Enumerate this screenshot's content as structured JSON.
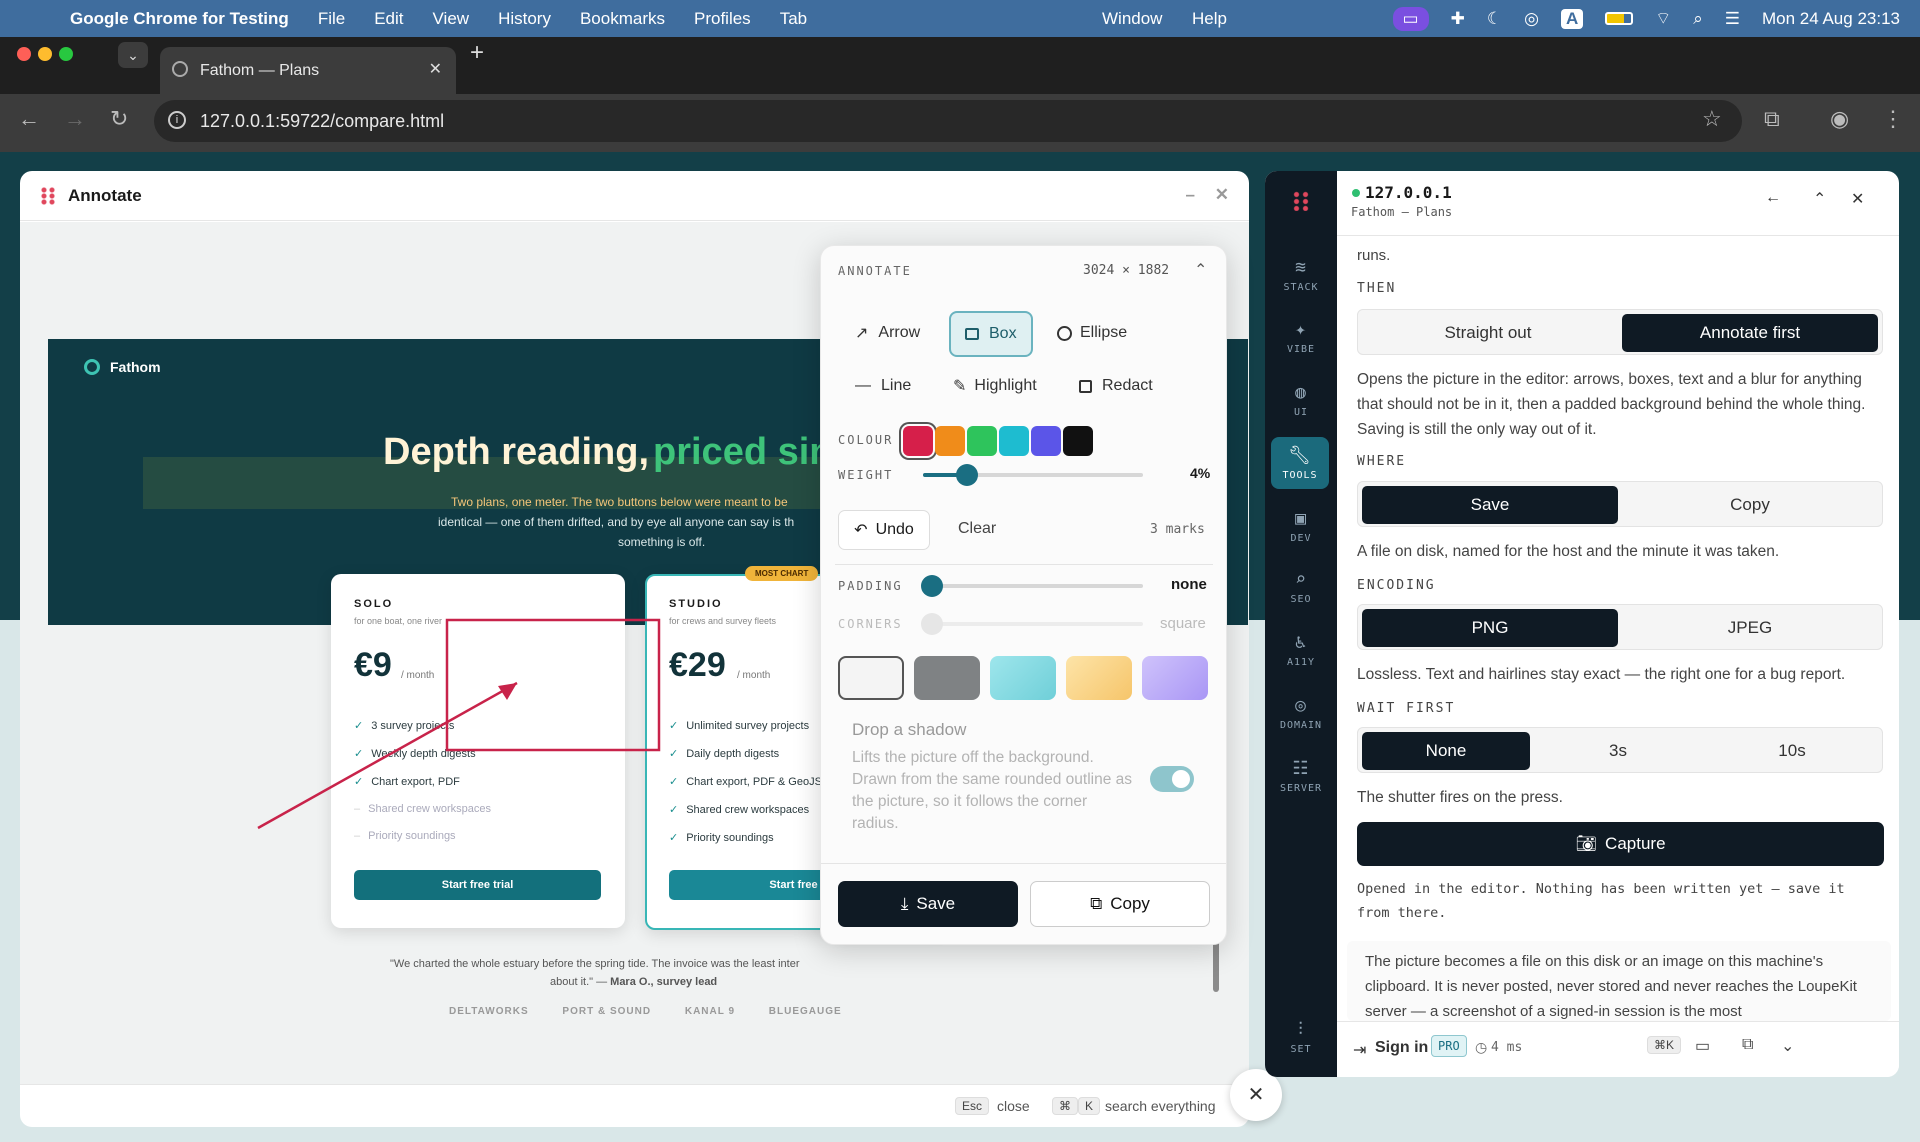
{
  "menubar": {
    "app": "Google Chrome for Testing",
    "items": [
      "File",
      "Edit",
      "View",
      "History",
      "Bookmarks",
      "Profiles",
      "Tab",
      "Window",
      "Help"
    ],
    "clock": "Mon 24 Aug  23:13"
  },
  "browser": {
    "tab_title": "Fathom — Plans",
    "url": "127.0.0.1:59722/compare.html"
  },
  "annotate": {
    "title": "Annotate",
    "footer": {
      "esc_key": "Esc",
      "esc_label": "close",
      "cmd_key": "⌘",
      "k_key": "K",
      "search_label": "search everything"
    },
    "preview": {
      "brand": "Fathom",
      "headline_a": "Depth reading,",
      "headline_b": "priced sin",
      "sub1": "Two plans, one meter. The two buttons below were meant to be",
      "sub2": "identical — one of them drifted, and by eye all anyone can say is th",
      "sub3": "something is off.",
      "solo": {
        "name": "SOLO",
        "tag": "for one boat, one river",
        "price": "€9",
        "per": "/ month",
        "features": [
          "3 survey projects",
          "Weekly depth digests",
          "Chart export, PDF",
          "Shared crew workspaces",
          "Priority soundings"
        ],
        "cta": "Start free trial"
      },
      "studio": {
        "badge": "MOST CHART",
        "name": "STUDIO",
        "tag": "for crews and survey fleets",
        "price": "€29",
        "per": "/ month",
        "features": [
          "Unlimited survey projects",
          "Daily depth digests",
          "Chart export, PDF & GeoJS",
          "Shared crew workspaces",
          "Priority soundings"
        ],
        "cta": "Start free tr"
      },
      "quote1": "\"We charted the whole estuary before the spring tide. The invoice was the least inter",
      "quote2": "about it.\" — ",
      "quote_author": "Mara O., survey lead",
      "logos": [
        "DELTAWORKS",
        "PORT & SOUND",
        "KANAL 9",
        "BLUEGAUGE"
      ]
    },
    "panel": {
      "label": "ANNOTATE",
      "dims": "3024 × 1882",
      "tools": [
        "Arrow",
        "Box",
        "Ellipse",
        "Line",
        "Highlight",
        "Redact"
      ],
      "colour_label": "COLOUR",
      "colours": [
        "#d61f4a",
        "#f08c1a",
        "#2ec45c",
        "#1ebcd0",
        "#5b55e8",
        "#111111"
      ],
      "weight_label": "WEIGHT",
      "weight_value": "4%",
      "weight_fraction": 0.2,
      "undo": "Undo",
      "clear": "Clear",
      "marks": "3 marks",
      "padding_label": "PADDING",
      "padding_value": "none",
      "corners_label": "CORNERS",
      "corners_value": "square",
      "shadow_title": "Drop a shadow",
      "shadow_desc": "Lifts the picture off the background. Drawn from the same rounded outline as the picture, so it follows the corner radius.",
      "save": "Save",
      "copy": "Copy"
    }
  },
  "dev": {
    "host": "127.0.0.1",
    "subtitle": "Fathom — Plans",
    "rail": [
      "STACK",
      "VIBE",
      "UI",
      "TOOLS",
      "DEV",
      "SEO",
      "A11Y",
      "DOMAIN",
      "SERVER",
      "SET"
    ],
    "top_text": "runs.",
    "then_label": "THEN",
    "then_opts": [
      "Straight out",
      "Annotate first"
    ],
    "then_desc": "Opens the picture in the editor: arrows, boxes, text and a blur for anything that should not be in it, then a padded background behind the whole thing. Saving is still the only way out of it.",
    "where_label": "WHERE",
    "where_opts": [
      "Save",
      "Copy"
    ],
    "where_desc": "A file on disk, named for the host and the minute it was taken.",
    "encoding_label": "ENCODING",
    "encoding_opts": [
      "PNG",
      "JPEG"
    ],
    "encoding_desc": "Lossless. Text and hairlines stay exact — the right one for a bug report.",
    "wait_label": "WAIT FIRST",
    "wait_opts": [
      "None",
      "3s",
      "10s"
    ],
    "wait_desc": "The shutter fires on the press.",
    "capture": "Capture",
    "status": "Opened in the editor. Nothing has been written yet — save it from there.",
    "privacy": "The picture becomes a file on this disk or an image on this machine's clipboard. It is never posted, never stored and never reaches the LoupeKit server — a screenshot of a signed-in session is the most",
    "footer": {
      "sign_in": "Sign in",
      "pro": "PRO",
      "timing": "4 ms",
      "kbd": "⌘K"
    }
  }
}
